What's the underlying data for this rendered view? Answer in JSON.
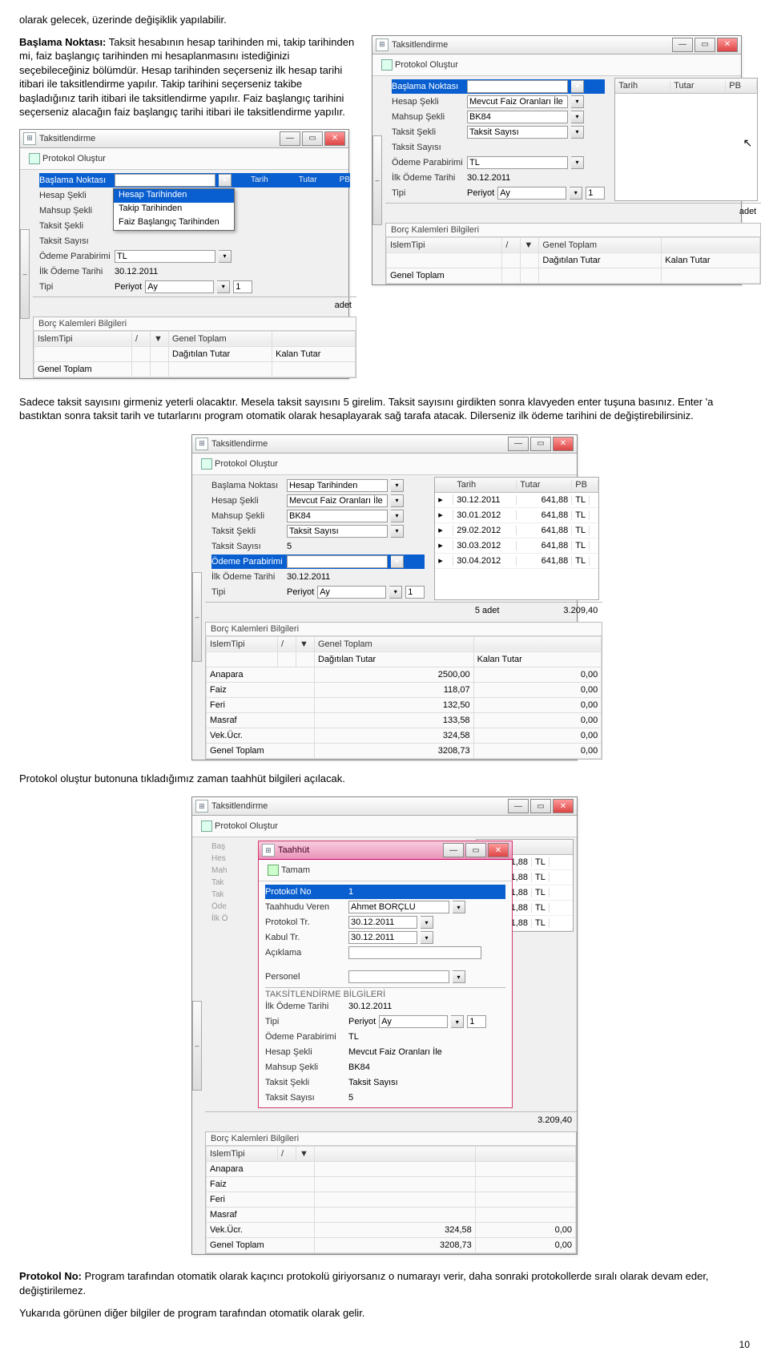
{
  "text": {
    "p0": "olarak gelecek, üzerinde değişiklik yapılabilir.",
    "p1_lead": "Başlama Noktası:",
    "p1": " Taksit hesabının hesap tarihinden mi, takip tarihinden mi, faiz başlangıç tarihinden mi hesaplanmasını istediğinizi seçebileceğiniz bölümdür. Hesap tarihinden seçerseniz ilk hesap tarihi itibari ile taksitlendirme yapılır. Takip tarihini seçerseniz takibe başladığınız tarih itibari ile taksitlendirme yapılır. Faiz başlangıç tarihini seçerseniz alacağın faiz başlangıç tarihi itibari ile taksitlendirme yapılır.",
    "p2": "Sadece taksit sayısını girmeniz yeterli olacaktır. Mesela taksit sayısını 5 girelim. Taksit sayısını girdikten sonra klavyeden enter tuşuna basınız. Enter 'a bastıktan sonra taksit tarih ve tutarlarını program otomatik olarak hesaplayarak sağ tarafa atacak. Dilerseniz ilk ödeme tarihini de değiştirebilirsiniz.",
    "p3": "Protokol oluştur butonuna tıkladığımız zaman taahhüt bilgileri açılacak.",
    "p4_lead": "Protokol No:",
    "p4": " Program tarafından otomatik olarak kaçıncı protokolü giriyorsanız o numarayı verir, daha sonraki protokollerde sıralı olarak devam eder, değiştirilemez.",
    "p5": "Yukarıda görünen diğer bilgiler de program tarafından otomatik olarak gelir.",
    "page_num": "10"
  },
  "win": {
    "title": "Taksitlendirme",
    "toolbar_btn": "Protokol Oluştur",
    "labels": {
      "baslama": "Başlama Noktası",
      "hesap_sekli": "Hesap Şekli",
      "mahsup_sekli": "Mahsup Şekli",
      "taksit_sekli": "Taksit Şekli",
      "taksit_sayisi": "Taksit Sayısı",
      "odeme_para": "Ödeme Parabirimi",
      "ilk_odeme": "İlk Ödeme Tarihi",
      "tipi": "Tipi",
      "periyot": "Periyot"
    },
    "values": {
      "hesap_tarihinden": "Hesap Tarihinden",
      "mevcut_faiz": "Mevcut Faiz Oranları İle",
      "bk84": "BK84",
      "faiz_baslangic": "Faiz Başlangıç Tarihinden",
      "takip_tarihinden": "Takip Tarihinden",
      "taksit_sayisi_val": "Taksit Sayısı",
      "tl": "TL",
      "tarih": "30.12.2011",
      "ay": "Ay",
      "bir": "1",
      "bes": "5"
    },
    "dropdown_opts": [
      "Hesap Tarihinden",
      "Takip Tarihinden",
      "Faiz Başlangıç Tarihinden"
    ],
    "grid_cols": [
      "Tarih",
      "Tutar",
      "PB"
    ],
    "grid_footer_adet": "adet",
    "borc_title": "Borç Kalemleri Bilgileri",
    "borc_cols": [
      "IslemTipi",
      "/",
      "▼",
      "Genel Toplam"
    ],
    "borc_sub": [
      "Dağıtılan Tutar",
      "Kalan Tutar"
    ],
    "genel_toplam": "Genel Toplam"
  },
  "shot3": {
    "rows": [
      {
        "t": "30.12.2011",
        "v": "641,88",
        "pb": "TL"
      },
      {
        "t": "30.01.2012",
        "v": "641,88",
        "pb": "TL"
      },
      {
        "t": "29.02.2012",
        "v": "641,88",
        "pb": "TL"
      },
      {
        "t": "30.03.2012",
        "v": "641,88",
        "pb": "TL"
      },
      {
        "t": "30.04.2012",
        "v": "641,88",
        "pb": "TL"
      }
    ],
    "footer_count": "5 adet",
    "footer_total": "3.209,40",
    "borc_rows": [
      {
        "n": "Anapara",
        "a": "2500,00",
        "b": "0,00"
      },
      {
        "n": "Faiz",
        "a": "118,07",
        "b": "0,00"
      },
      {
        "n": "Feri",
        "a": "132,50",
        "b": "0,00"
      },
      {
        "n": "Masraf",
        "a": "133,58",
        "b": "0,00"
      },
      {
        "n": "Vek.Ücr.",
        "a": "324,58",
        "b": "0,00"
      },
      {
        "n": "Genel Toplam",
        "a": "3208,73",
        "b": "0,00"
      }
    ]
  },
  "shot4": {
    "taahhut_title": "Taahhüt",
    "tamam": "Tamam",
    "protokol_no": "Protokol No",
    "protokol_no_v": "1",
    "taahhudu_veren": "Taahhudu Veren",
    "taahhudu_veren_v": "Ahmet BORÇLU",
    "protokol_tr": "Protokol Tr.",
    "kabul_tr": "Kabul Tr.",
    "aciklama": "Açıklama",
    "personel": "Personel",
    "tak_bilgi": "TAKSİTLENDİRME BİLGİLERİ",
    "rows": [
      {
        "v": "641,88",
        "pb": "TL"
      },
      {
        "v": "641,88",
        "pb": "TL"
      },
      {
        "v": "641,88",
        "pb": "TL"
      },
      {
        "v": "641,88",
        "pb": "TL"
      },
      {
        "v": "641,88",
        "pb": "TL"
      }
    ],
    "footer_total": "3.209,40",
    "borc_partial": [
      {
        "n": "Anapara"
      },
      {
        "n": "Faiz"
      },
      {
        "n": "Feri"
      },
      {
        "n": "Masraf"
      },
      {
        "n": "Vek.Ücr.",
        "a": "324,58",
        "b": "0,00"
      },
      {
        "n": "Genel Toplam",
        "a": "3208,73",
        "b": "0,00"
      }
    ]
  }
}
